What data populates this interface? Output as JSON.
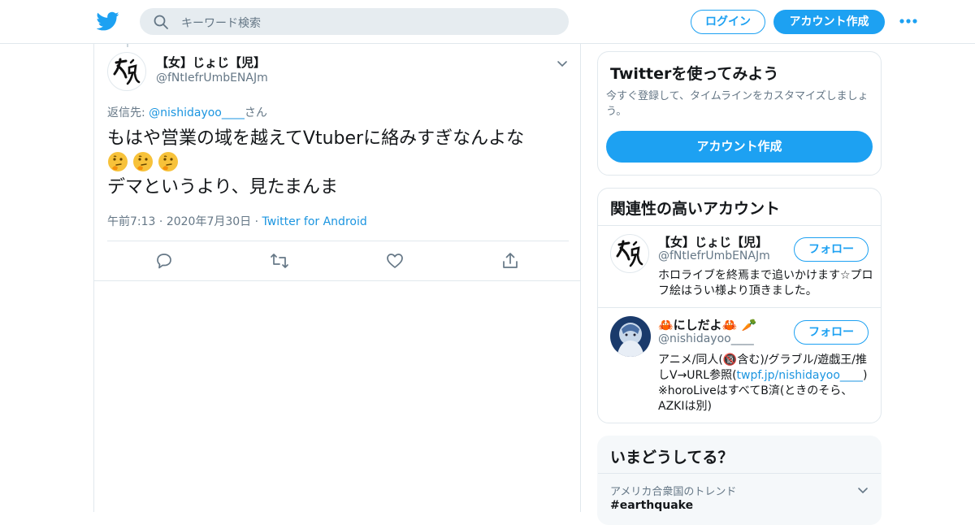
{
  "header": {
    "search_placeholder": "キーワード検索",
    "login_label": "ログイン",
    "signup_label": "アカウント作成"
  },
  "tweet": {
    "author_name": "【女】じょじ【児】",
    "author_handle": "@fNtIefrUmbENAJm",
    "reply_prefix": "返信先: ",
    "reply_mention": "@nishidayoo____",
    "reply_suffix": "さん",
    "text_line1": "もはや営業の域を越えてVtuberに絡みすぎなんよな",
    "text_line3": "デマというより、見たまんま",
    "time": "午前7:13",
    "date": "2020年7月30日",
    "source": "Twitter for Android",
    "emoji": [
      "thinking-face-emoji",
      "thinking-face-emoji",
      "thinking-face-emoji"
    ]
  },
  "sidebar": {
    "signup_card": {
      "title": "Twitterを使ってみよう",
      "description": "今すぐ登録して、タイムラインをカスタマイズしましょう。",
      "button_label": "アカウント作成"
    },
    "related_card": {
      "title": "関連性の高いアカウント",
      "accounts": [
        {
          "name": "【女】じょじ【児】",
          "handle": "@fNtIefrUmbENAJm",
          "bio": "ホロライブを終焉まで追いかけます☆プロフ絵はうい様より頂きました。",
          "follow_label": "フォロー"
        },
        {
          "name": "🦀にしだよ🦀 🥕",
          "handle": "@nishidayoo____",
          "bio_part1": "アニメ/同人(🔞含む)/グラブル/遊戯王/推しV→URL参照(",
          "bio_link": "twpf.jp/nishidayoo____",
          "bio_part2": ") ※horoLiveはすべてB済(ときのそら、AZKIは別)",
          "follow_label": "フォロー"
        }
      ]
    },
    "trends_card": {
      "title": "いまどうしてる？",
      "trend_location": "アメリカ合衆国のトレンド",
      "trend_name": "#earthquake"
    }
  },
  "colors": {
    "accent": "#1da1f2",
    "link": "#1b95e0",
    "secondary_text": "#657786",
    "border": "#e1e8ed"
  }
}
